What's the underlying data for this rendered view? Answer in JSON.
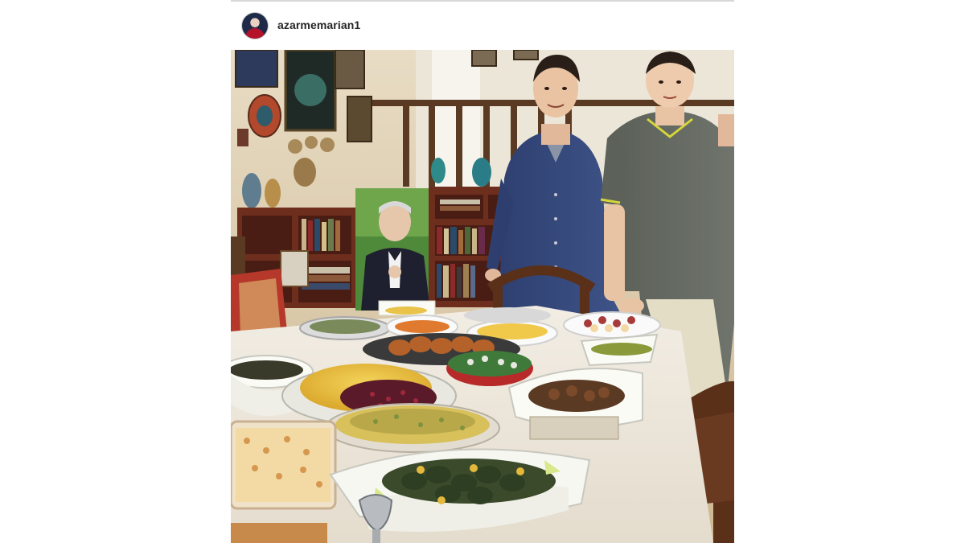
{
  "post": {
    "username": "azarmemarian1",
    "avatar_icon": "profile-avatar-icon"
  },
  "photo": {
    "description_icon": "photo-dinner-table-icon"
  }
}
